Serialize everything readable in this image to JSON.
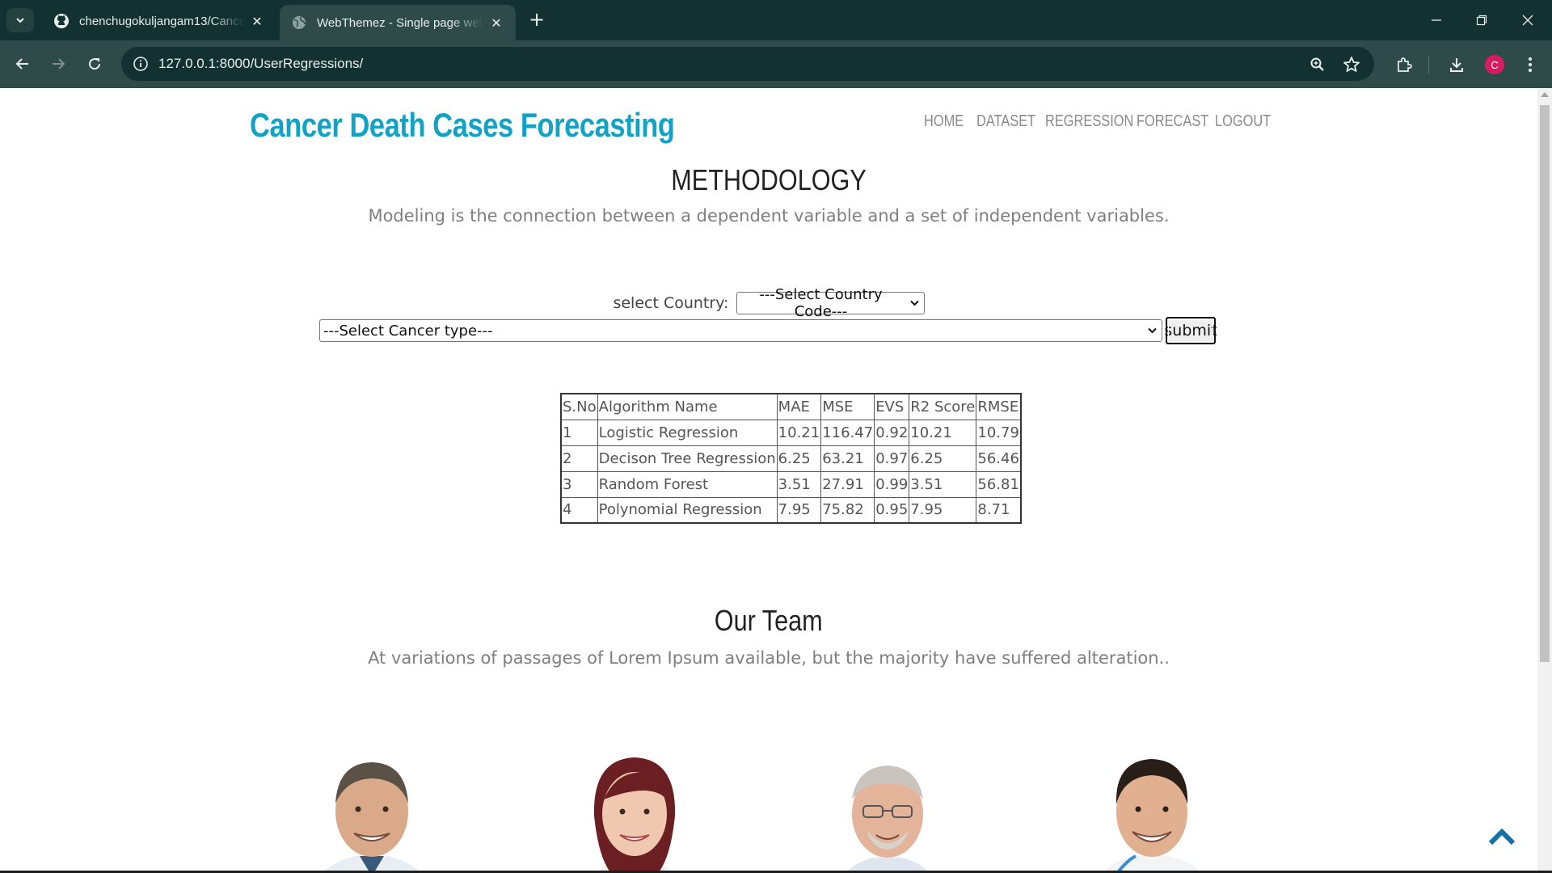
{
  "browser": {
    "tabs": [
      {
        "title": "chenchugokuljangam13/Cancer",
        "active": false,
        "favicon": "github-icon"
      },
      {
        "title": "WebThemez - Single page website",
        "active": true,
        "favicon": "globe-icon"
      }
    ],
    "url": "127.0.0.1:8000/UserRegressions/",
    "profile_initial": "C",
    "accent_colors": {
      "chrome_dark": "#123130",
      "chrome_toolbar": "#2e4a49",
      "profile": "#d81b60"
    }
  },
  "site": {
    "brand": "Cancer Death Cases Forecasting",
    "brand_color": "#10a3c6",
    "nav": [
      "HOME",
      "DATASET",
      "REGRESSION",
      "FORECAST",
      "LOGOUT"
    ]
  },
  "methodology": {
    "title": "METHODOLOGY",
    "subtitle": "Modeling is the connection between a dependent variable and a set of independent variables."
  },
  "form": {
    "country_label": "select Country:",
    "country_selected": "---Select Country Code---",
    "cancer_selected": "---Select Cancer type---",
    "submit_label": "submit"
  },
  "results_table": {
    "headers": [
      "S.No",
      "Algorithm Name",
      "MAE",
      "MSE",
      "EVS",
      "R2 Score",
      "RMSE"
    ],
    "rows": [
      [
        "1",
        "Logistic Regression",
        "10.21",
        "116.47",
        "0.92",
        "10.21",
        "10.79"
      ],
      [
        "2",
        "Decison Tree Regression",
        "6.25",
        "63.21",
        "0.97",
        "6.25",
        "56.46"
      ],
      [
        "3",
        "Random Forest",
        "3.51",
        "27.91",
        "0.99",
        "3.51",
        "56.81"
      ],
      [
        "4",
        "Polynomial Regression",
        "7.95",
        "75.82",
        "0.95",
        "7.95",
        "8.71"
      ]
    ]
  },
  "team": {
    "title": "Our Team",
    "subtitle": "At variations of passages of Lorem Ipsum available, but the majority have suffered alteration..",
    "members": [
      "doctor-photo",
      "nurse-photo",
      "senior-doctor-photo",
      "young-doctor-photo"
    ]
  },
  "back_to_top_icon": "chevron-up-icon"
}
